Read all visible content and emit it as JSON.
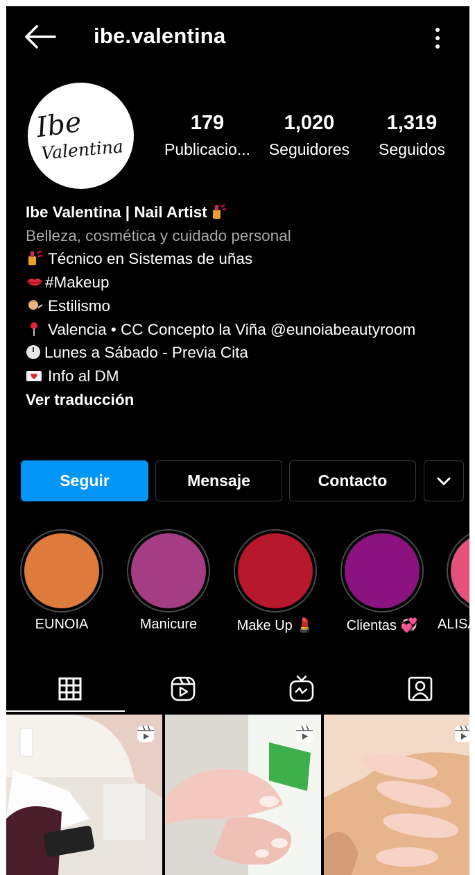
{
  "header": {
    "username": "ibe.valentina"
  },
  "profile": {
    "avatar_text_line1": "Ibe",
    "avatar_text_line2": "Valentina",
    "stats": [
      {
        "value": "179",
        "label": "Publicacio..."
      },
      {
        "value": "1,020",
        "label": "Seguidores"
      },
      {
        "value": "1,319",
        "label": "Seguidos"
      }
    ]
  },
  "bio": {
    "name": "Ibe Valentina | Nail Artist",
    "category": "Belleza, cosmética y cuidado personal",
    "lines": [
      {
        "icon": "nail-polish-icon",
        "text": "Técnico en Sistemas de uñas"
      },
      {
        "icon": "lips-icon",
        "text": "#Makeup"
      },
      {
        "icon": "haircut-icon",
        "text": "Estilismo"
      },
      {
        "icon": "pin-icon",
        "text": "Valencia • CC Concepto la Viña @eunoiabeautyroom"
      },
      {
        "icon": "clock-icon",
        "text": "Lunes a Sábado - Previa Cita"
      },
      {
        "icon": "love-letter-icon",
        "text": "Info al DM"
      }
    ],
    "translate": "Ver traducción"
  },
  "actions": {
    "follow": "Seguir",
    "message": "Mensaje",
    "contact": "Contacto"
  },
  "highlights": [
    {
      "label": "EUNOIA",
      "color": "#dd7a3c"
    },
    {
      "label": "Manicure",
      "color": "#a43d83"
    },
    {
      "label": "Make Up 💄",
      "color": "#b7182b"
    },
    {
      "label": "Clientas 💞",
      "color": "#8a137f"
    },
    {
      "label": "ALISA",
      "color": "#e3517d"
    }
  ],
  "tabs": [
    "grid-icon",
    "reels-icon",
    "igtv-icon",
    "tagged-icon"
  ],
  "colors": {
    "accent": "#0095f6",
    "background": "#000000",
    "muted": "#a8a8a8"
  }
}
